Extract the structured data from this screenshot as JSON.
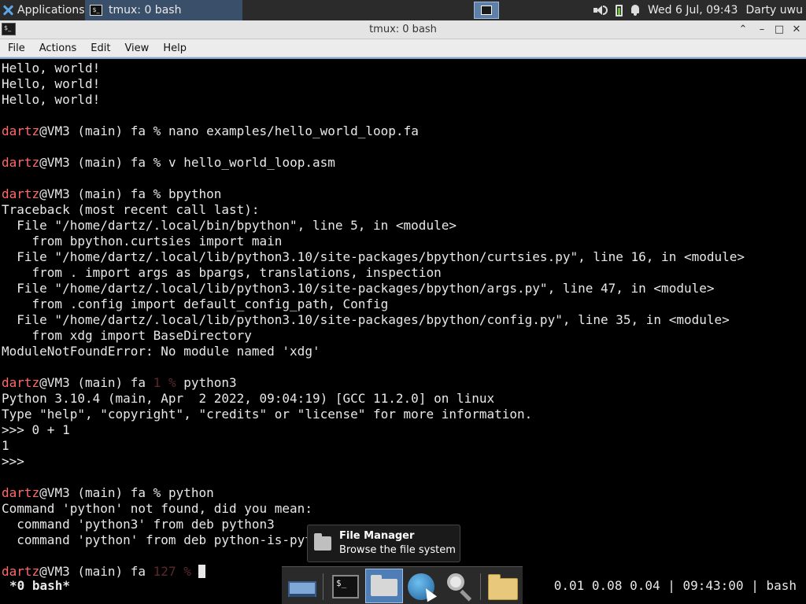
{
  "top_panel": {
    "applications_label": "Applications",
    "task_title": "tmux: 0 bash",
    "clock": "Wed  6 Jul, 09:43",
    "user": "Darty uwu"
  },
  "window": {
    "title": "tmux: 0 bash",
    "menu": [
      "File",
      "Actions",
      "Edit",
      "View",
      "Help"
    ]
  },
  "terminal": {
    "lines": [
      "Hello, world!",
      "Hello, world!",
      "Hello, world!",
      "",
      {
        "user": "dartz",
        "host": "@VM3 (main) fa",
        "code": "",
        "sym": "%",
        "cmd": " nano examples/hello_world_loop.fa"
      },
      "",
      {
        "user": "dartz",
        "host": "@VM3 (main) fa",
        "code": "",
        "sym": "%",
        "cmd": " v hello_world_loop.asm"
      },
      "",
      {
        "user": "dartz",
        "host": "@VM3 (main) fa",
        "code": "",
        "sym": "%",
        "cmd": " bpython"
      },
      "Traceback (most recent call last):",
      "  File \"/home/dartz/.local/bin/bpython\", line 5, in <module>",
      "    from bpython.curtsies import main",
      "  File \"/home/dartz/.local/lib/python3.10/site-packages/bpython/curtsies.py\", line 16, in <module>",
      "    from . import args as bpargs, translations, inspection",
      "  File \"/home/dartz/.local/lib/python3.10/site-packages/bpython/args.py\", line 47, in <module>",
      "    from .config import default_config_path, Config",
      "  File \"/home/dartz/.local/lib/python3.10/site-packages/bpython/config.py\", line 35, in <module>",
      "    from xdg import BaseDirectory",
      "ModuleNotFoundError: No module named 'xdg'",
      "",
      {
        "user": "dartz",
        "host": "@VM3 (main) fa",
        "code": "1",
        "sym": "%",
        "cmd": " python3"
      },
      "Python 3.10.4 (main, Apr  2 2022, 09:04:19) [GCC 11.2.0] on linux",
      "Type \"help\", \"copyright\", \"credits\" or \"license\" for more information.",
      ">>> 0 + 1",
      "1",
      ">>>",
      "",
      {
        "user": "dartz",
        "host": "@VM3 (main) fa",
        "code": "",
        "sym": "%",
        "cmd": " python"
      },
      "Command 'python' not found, did you mean:",
      "  command 'python3' from deb python3",
      "  command 'python' from deb python-is-python3",
      "",
      {
        "user": "dartz",
        "host": "@VM3 (main) fa",
        "code": "127",
        "sym": "%",
        "cmd": " ",
        "cursor": true
      }
    ],
    "status_window": "*0 bash*",
    "status_right": "0.01 0.08 0.04 | 09:43:00 | bash"
  },
  "tooltip": {
    "title": "File Manager",
    "subtitle": "Browse the file system"
  },
  "dock": {
    "items": [
      "show-desktop",
      "terminal",
      "home-folder",
      "web-browser",
      "app-finder",
      "file-folder"
    ]
  },
  "colors": {
    "prompt_user": "#ff6a6a",
    "prompt_code": "#5a2a2a",
    "terminal_bg": "#000000",
    "terminal_fg": "#e8e8e8"
  }
}
